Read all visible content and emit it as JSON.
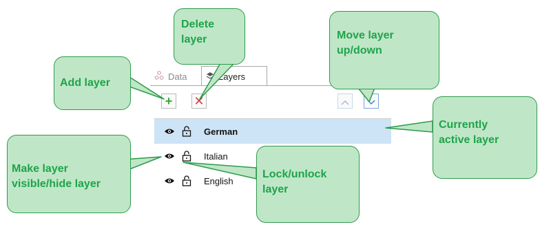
{
  "panel": {
    "tabs": [
      {
        "label": "Data",
        "icon": "data-icon",
        "active": false
      },
      {
        "label": "Layers",
        "icon": "layers-icon",
        "active": true
      }
    ],
    "toolbar": {
      "add_icon": "plus-icon",
      "delete_icon": "x-icon",
      "up_icon": "chevron-up-icon",
      "down_icon": "chevron-down-icon"
    },
    "layers": [
      {
        "name": "German",
        "active": true,
        "visible_icon": "eye-icon",
        "lock_icon": "unlock-icon"
      },
      {
        "name": "Italian",
        "active": false,
        "visible_icon": "eye-icon",
        "lock_icon": "unlock-icon"
      },
      {
        "name": "English",
        "active": false,
        "visible_icon": "eye-icon",
        "lock_icon": "unlock-icon"
      }
    ],
    "colors": {
      "active_row": "#cde3f6",
      "add": "#39a839",
      "delete": "#e03a3a",
      "down": "#3d7fc4"
    }
  },
  "callouts": {
    "add_layer": "Add layer",
    "delete_layer": "Delete layer",
    "move_layer": "Move layer up/down",
    "active_layer": "Currently active layer",
    "visible_layer": "Make layer visible/hide layer",
    "lock_layer": "Lock/unlock layer",
    "colors": {
      "fill": "#bfe7c7",
      "border": "#2c9a4a",
      "text": "#1fa34a"
    }
  }
}
